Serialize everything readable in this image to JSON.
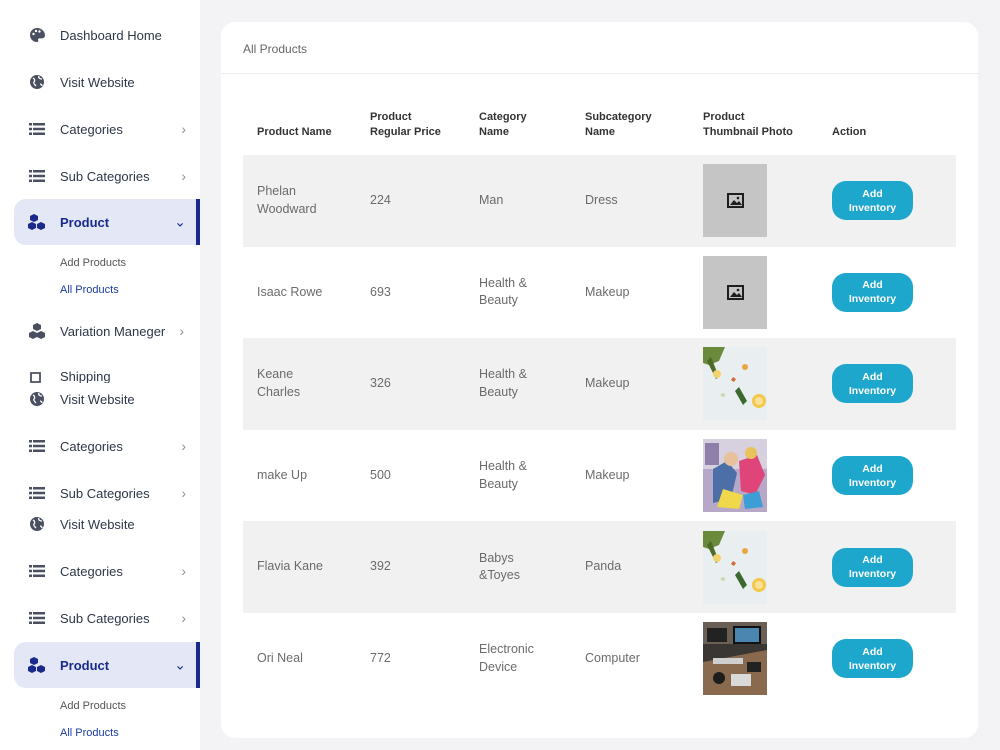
{
  "sidebar": {
    "items": [
      {
        "label": "Dashboard Home",
        "icon": "palette-icon"
      },
      {
        "label": "Visit Website",
        "icon": "globe-icon"
      },
      {
        "label": "Categories",
        "icon": "list-icon",
        "chevron": "›"
      },
      {
        "label": "Sub Categories",
        "icon": "list-icon",
        "chevron": "›"
      },
      {
        "label": "Product",
        "icon": "cubes-icon",
        "chevron": "⌄"
      },
      {
        "label": "Variation Maneger",
        "icon": "cubes-icon",
        "chevron": "›"
      },
      {
        "label": "Shipping",
        "icon": "truck-icon"
      },
      {
        "label": "Visit Website",
        "icon": "globe-icon"
      },
      {
        "label": "Categories",
        "icon": "list-icon",
        "chevron": "›"
      },
      {
        "label": "Sub Categories",
        "icon": "list-icon",
        "chevron": "›"
      },
      {
        "label": "Visit Website",
        "icon": "globe-icon"
      },
      {
        "label": "Categories",
        "icon": "list-icon",
        "chevron": "›"
      },
      {
        "label": "Sub Categories",
        "icon": "list-icon",
        "chevron": "›"
      },
      {
        "label": "Product",
        "icon": "cubes-icon",
        "chevron": "⌄"
      }
    ],
    "submenu_top": {
      "add": "Add Products",
      "all": "All Products"
    },
    "submenu_bottom": {
      "add": "Add Products",
      "all": "All Products"
    },
    "accent_color": "#1a2a8c"
  },
  "page": {
    "title": "All Products"
  },
  "table": {
    "headers": {
      "name": "Product Name",
      "price_1": "Product",
      "price_2": "Regular Price",
      "cat_1": "Category",
      "cat_2": "Name",
      "sub_1": "Subcategory",
      "sub_2": "Name",
      "thumb_1": "Product",
      "thumb_2": "Thumbnail Photo",
      "action": "Action"
    },
    "rows": [
      {
        "name": "Phelan Woodward",
        "price": "224",
        "category": "Man",
        "subcategory": "Dress",
        "thumb": "placeholder-image-icon",
        "action": "Add Inventory"
      },
      {
        "name": "Isaac Rowe",
        "price": "693",
        "category": "Health & Beauty",
        "subcategory": "Makeup",
        "thumb": "placeholder-image-icon",
        "action": "Add Inventory"
      },
      {
        "name": "Keane Charles",
        "price": "326",
        "category": "Health & Beauty",
        "subcategory": "Makeup",
        "thumb": "flatlay-photo",
        "action": "Add Inventory"
      },
      {
        "name": "make Up",
        "price": "500",
        "category": "Health & Beauty",
        "subcategory": "Makeup",
        "thumb": "kids-photo",
        "action": "Add Inventory"
      },
      {
        "name": "Flavia Kane",
        "price": "392",
        "category": "Babys &Toyes",
        "subcategory": "Panda",
        "thumb": "flatlay-photo",
        "action": "Add Inventory"
      },
      {
        "name": "Ori Neal",
        "price": "772",
        "category": "Electronic Device",
        "subcategory": "Computer",
        "thumb": "desk-photo",
        "action": "Add Inventory"
      }
    ]
  },
  "button_color": "#1ea7cc"
}
